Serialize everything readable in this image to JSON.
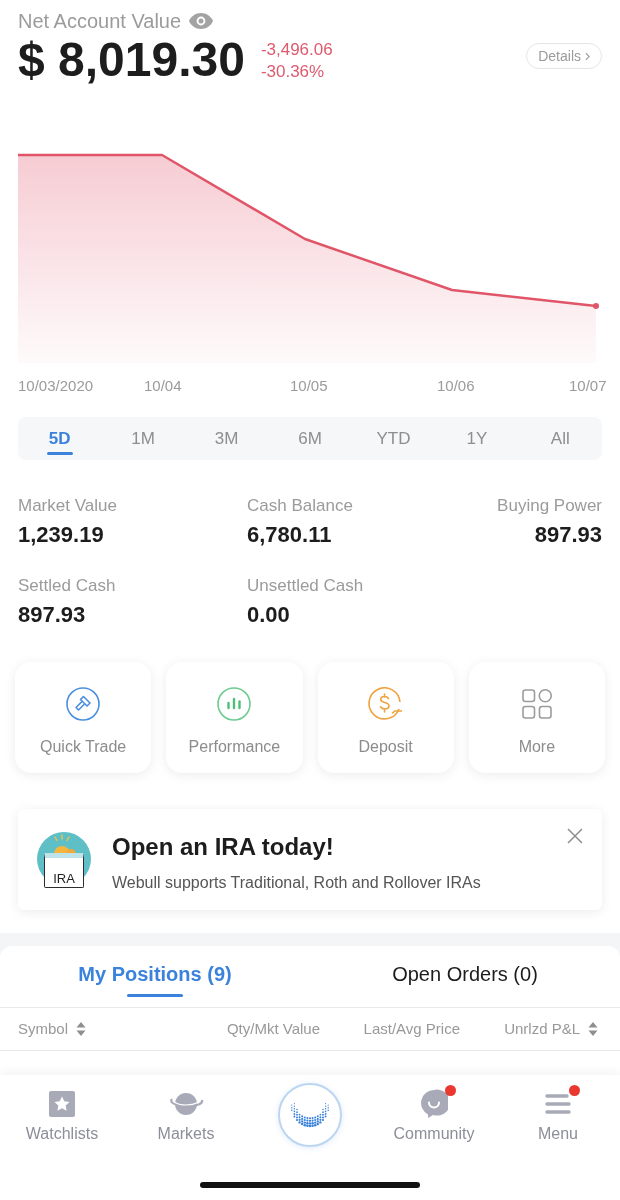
{
  "account": {
    "title": "Net Account Value",
    "value": "$ 8,019.30",
    "change": "-3,496.06",
    "change_percent": "-30.36%",
    "details_button": "Details"
  },
  "chart": {
    "x_labels": [
      "10/03/2020",
      "10/04",
      "10/05",
      "10/06",
      "10/07"
    ]
  },
  "ranges": [
    {
      "label": "5D",
      "selected": true
    },
    {
      "label": "1M",
      "selected": false
    },
    {
      "label": "3M",
      "selected": false
    },
    {
      "label": "6M",
      "selected": false
    },
    {
      "label": "YTD",
      "selected": false
    },
    {
      "label": "1Y",
      "selected": false
    },
    {
      "label": "All",
      "selected": false
    }
  ],
  "balances": [
    {
      "label": "Market Value",
      "value": "1,239.19"
    },
    {
      "label": "Cash Balance",
      "value": "6,780.11"
    },
    {
      "label": "Buying Power",
      "value": "897.93"
    },
    {
      "label": "Settled Cash",
      "value": "897.93"
    },
    {
      "label": "Unsettled Cash",
      "value": "0.00"
    }
  ],
  "actions": [
    {
      "label": "Quick Trade",
      "kind": "quick_trade"
    },
    {
      "label": "Performance",
      "kind": "performance"
    },
    {
      "label": "Deposit",
      "kind": "deposit"
    },
    {
      "label": "More",
      "kind": "more"
    }
  ],
  "promo": {
    "badge": "IRA",
    "title": "Open an IRA today!",
    "text": "Webull supports Traditional, Roth and Rollover IRAs"
  },
  "position_tabs": [
    {
      "label": "My Positions (9)",
      "selected": true
    },
    {
      "label": "Open Orders (0)",
      "selected": false
    }
  ],
  "columns": [
    {
      "label": "Symbol",
      "sortable": true
    },
    {
      "label": "Qty/Mkt Value",
      "sortable": false
    },
    {
      "label": "Last/Avg Price",
      "sortable": false
    },
    {
      "label": "Unrlzd P&L",
      "sortable": true
    }
  ],
  "bottom_nav": [
    {
      "kind": "watchlists",
      "label": "Watchlists",
      "badge": false
    },
    {
      "kind": "markets",
      "label": "Markets",
      "badge": false
    },
    {
      "kind": "home"
    },
    {
      "kind": "community",
      "label": "Community",
      "badge": true
    },
    {
      "kind": "menu",
      "label": "Menu",
      "badge": true
    }
  ]
}
